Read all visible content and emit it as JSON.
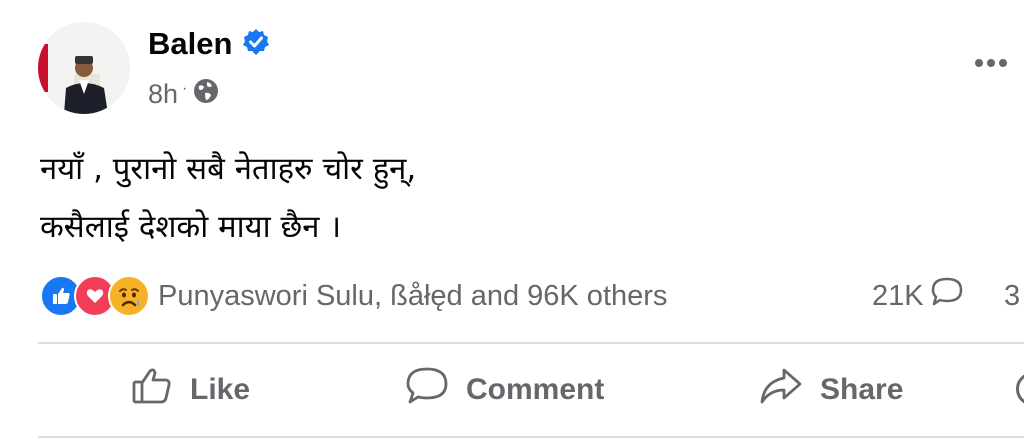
{
  "post": {
    "author": "Balen",
    "time": "8h",
    "separator": "·",
    "text_lines": [
      "नयाँ , पुरानो सबै नेताहरु चोर हुन्,",
      "कसैलाई देशको माया छैन ।"
    ]
  },
  "reactions": {
    "icons": [
      "like-reaction-icon",
      "love-reaction-icon",
      "sad-reaction-icon"
    ],
    "summary": "Punyaswori Sulu, ßåłęd and 96K others",
    "comments": "21K",
    "shares": "3"
  },
  "actions": {
    "like": "Like",
    "comment": "Comment",
    "share": "Share"
  },
  "colors": {
    "verified": "#1877f2",
    "muted": "#65676b",
    "like": "#1877f2",
    "love": "#f33e58",
    "sad": "#f7b125"
  }
}
